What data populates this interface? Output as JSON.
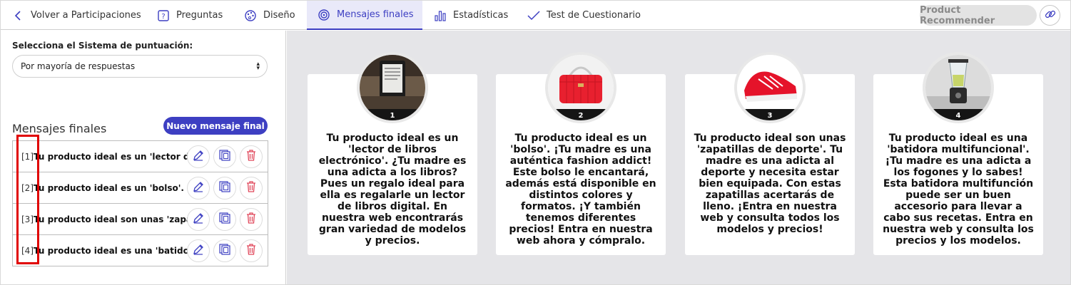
{
  "nav": {
    "back_label": "Volver a Participaciones",
    "questions_label": "Preguntas",
    "design_label": "Diseño",
    "final_messages_label": "Mensajes finales",
    "stats_label": "Estadísticas",
    "test_label": "Test de Cuestionario",
    "recommender_label": "Product Recommender"
  },
  "left": {
    "scoring_label": "Selecciona el Sistema de puntuación:",
    "scoring_value": "Por mayoría de respuestas",
    "final_messages_title": "Mensajes finales",
    "new_message_button": "Nuevo mensaje final",
    "rows": [
      {
        "index": "[1]",
        "text": "Tu producto ideal es un 'lector de libros electrónico'."
      },
      {
        "index": "[2]",
        "text": "Tu producto ideal es un 'bolso'. ¡Tu madre es una auténtica fashion addict!"
      },
      {
        "index": "[3]",
        "text": "Tu producto ideal son unas 'zapatillas de deporte'."
      },
      {
        "index": "[4]",
        "text": "Tu producto ideal es una 'batidora multifuncional'."
      }
    ]
  },
  "cards": [
    {
      "number": "1",
      "image": "ebook-reader-photo",
      "text": "Tu producto ideal es un 'lector de libros electrónico'. ¿Tu madre es una adicta a los libros? Pues un regalo ideal para ella es regalarle un lector de libros digital. En nuestra web encontrarás gran variedad de modelos y precios."
    },
    {
      "number": "2",
      "image": "red-handbag-photo",
      "text": "Tu producto ideal es un 'bolso'. ¡Tu madre es una auténtica fashion addict! Este bolso le encantará, además está disponible en distintos colores y formatos. ¡Y también tenemos diferentes precios! Entra en nuestra web ahora y cómpralo."
    },
    {
      "number": "3",
      "image": "red-sneaker-photo",
      "text": "Tu producto ideal son unas 'zapatillas de deporte'. Tu madre es una adicta al deporte y necesita estar bien equipada. Con estas zapatillas acertarás de lleno. ¡Entra en nuestra web y consulta todos los modelos y precios!"
    },
    {
      "number": "4",
      "image": "blender-photo",
      "text": "Tu producto ideal es una 'batidora multifuncional'.¡Tu madre es una adicta a los fogones y lo sabes! Esta batidora multifunción puede ser un buen accesorio para llevar a cabo sus recetas. Entra en nuestra web y consulta los precios y los modelos."
    }
  ],
  "colors": {
    "accent": "#3d3fc2",
    "delete": "#e0475b",
    "highlight": "#e00000",
    "canvas": "#e5e5e8"
  }
}
